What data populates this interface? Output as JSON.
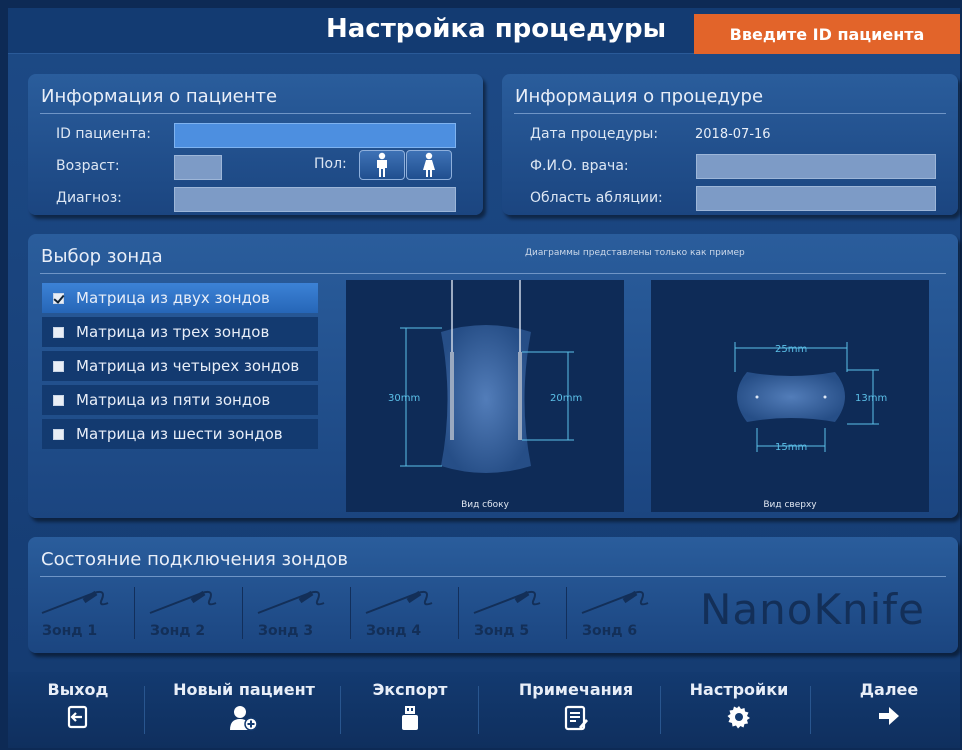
{
  "header": {
    "title": "Настройка процедуры",
    "patient_id_banner": "Введите ID пациента"
  },
  "patient_info": {
    "title": "Информация о пациенте",
    "id_label": "ID пациента:",
    "id_value": "",
    "age_label": "Возраст:",
    "age_value": "",
    "sex_label": "Пол:",
    "diagnosis_label": "Диагноз:",
    "diagnosis_value": ""
  },
  "procedure_info": {
    "title": "Информация о процедуре",
    "date_label": "Дата процедуры:",
    "date_value": "2018-07-16",
    "doctor_label": "Ф.И.О. врача:",
    "doctor_value": "",
    "ablation_label": "Область абляции:",
    "ablation_value": ""
  },
  "probe_selection": {
    "title": "Выбор зонда",
    "disclaimer": "Диаграммы представлены только как пример",
    "options": [
      {
        "label": "Матрица из двух зондов",
        "checked": true
      },
      {
        "label": "Матрица из трех зондов",
        "checked": false
      },
      {
        "label": "Матрица из четырех зондов",
        "checked": false
      },
      {
        "label": "Матрица из пяти зондов",
        "checked": false
      },
      {
        "label": "Матрица из шести зондов",
        "checked": false
      }
    ],
    "side_view": {
      "caption": "Вид сбоку",
      "height_label": "30mm",
      "probe_label": "20mm"
    },
    "top_view": {
      "caption": "Вид сверху",
      "width_label": "25mm",
      "height_label": "13mm",
      "spacing_label": "15mm"
    }
  },
  "connection": {
    "title": "Состояние подключения зондов",
    "probes": [
      "Зонд 1",
      "Зонд 2",
      "Зонд 3",
      "Зонд 4",
      "Зонд 5",
      "Зонд 6"
    ],
    "brand": "NanoKnife"
  },
  "nav": {
    "exit": "Выход",
    "new_patient": "Новый пациент",
    "export": "Экспорт",
    "notes": "Примечания",
    "settings": "Настройки",
    "next": "Далее"
  },
  "colors": {
    "accent": "#e2642a",
    "selected": "#2f74c8",
    "panel": "#214f8d"
  }
}
